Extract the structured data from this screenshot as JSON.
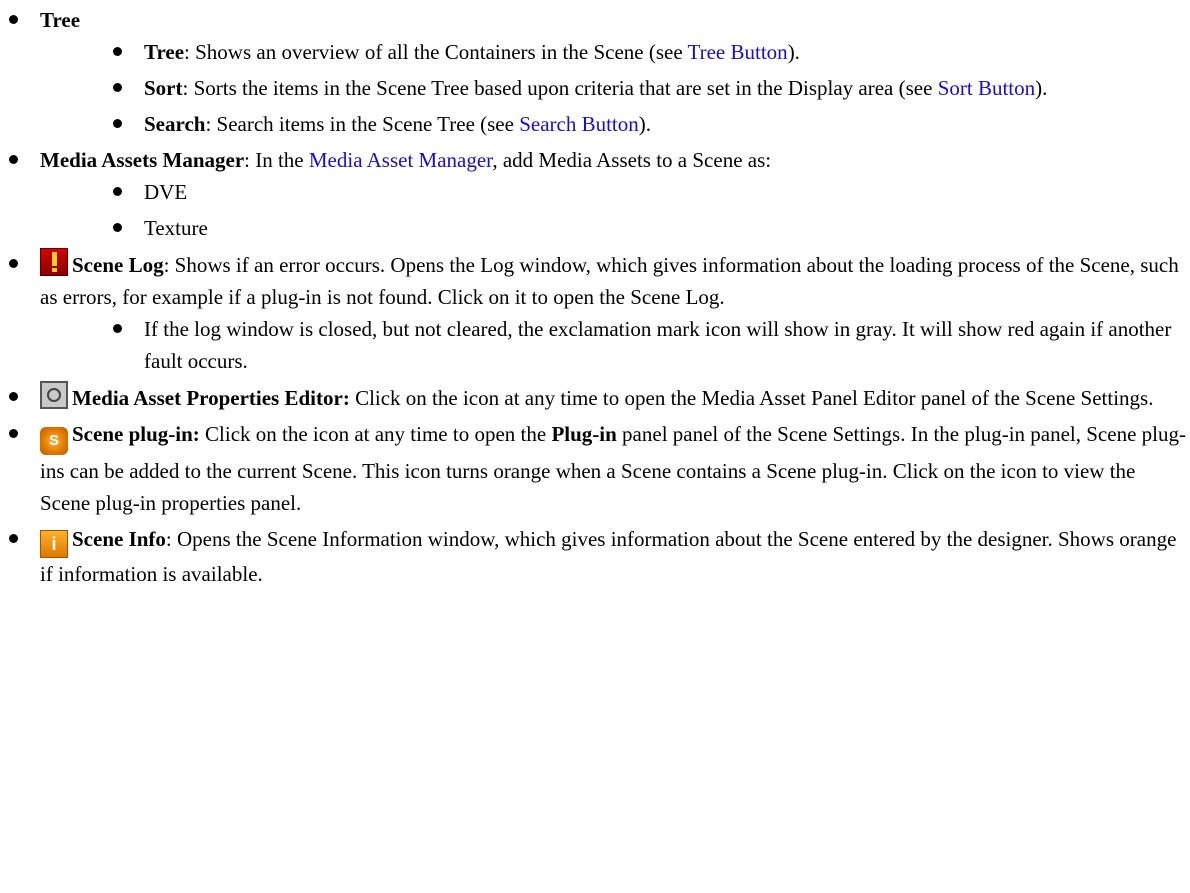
{
  "items": [
    {
      "label": "Tree",
      "children": [
        {
          "label": "Tree",
          "text1": ": Shows an overview of all the Containers in the Scene (see ",
          "link": "Tree Button",
          "text2": ")."
        },
        {
          "label": "Sort",
          "text1": ": Sorts the items in the Scene Tree based upon criteria that are set in the Display area (see ",
          "link": "Sort Button",
          "text2": ")."
        },
        {
          "label": "Search",
          "text1": ": Search items in the Scene Tree (see ",
          "link": "Search Button",
          "text2": ")."
        }
      ]
    },
    {
      "label": "Media Assets Manager",
      "text1": ": In the ",
      "link": "Media Asset Manager",
      "text2": ", add Media Assets to a Scene as:",
      "children": [
        {
          "text": "DVE"
        },
        {
          "text": "Texture"
        }
      ]
    },
    {
      "icon": "exclamation-icon",
      "label": "Scene Log",
      "text1": ": Shows if an error occurs. Opens the Log window, which gives information about the loading process of the Scene, such as errors, for example if a plug-in is not found. Click on it to open the Scene Log.",
      "children": [
        {
          "text": "If the log window is closed, but not cleared, the exclamation mark icon will show in gray. It will show red again if another fault occurs."
        }
      ]
    },
    {
      "icon": "media-asset-properties-icon",
      "label": "Media Asset Properties Editor:",
      "text1": " Click on the icon at any time to open the Media Asset Panel Editor panel of the Scene Settings."
    },
    {
      "icon": "scene-plugin-icon",
      "icon_glyph": "S",
      "label": "Scene plug-in:",
      "text1": " Click on the icon at any time to open the ",
      "bold2": "Plug-in",
      "text2": " panel panel of the Scene Settings. In the plug-in panel, Scene plug-ins can be added to the current Scene. This icon turns orange when a Scene contains a Scene plug-in. Click on the icon to view the Scene plug-in properties panel."
    },
    {
      "icon": "info-icon",
      "icon_glyph": "i",
      "label": "Scene Info",
      "text1": ": Opens the Scene Information window, which gives information about the Scene entered by the designer. Shows orange if information is available."
    }
  ],
  "colors": {
    "link": "#1a0dcc",
    "log_icon": "#c00000",
    "plugin_icon": "#e37b00",
    "info_icon": "#f59a10"
  }
}
